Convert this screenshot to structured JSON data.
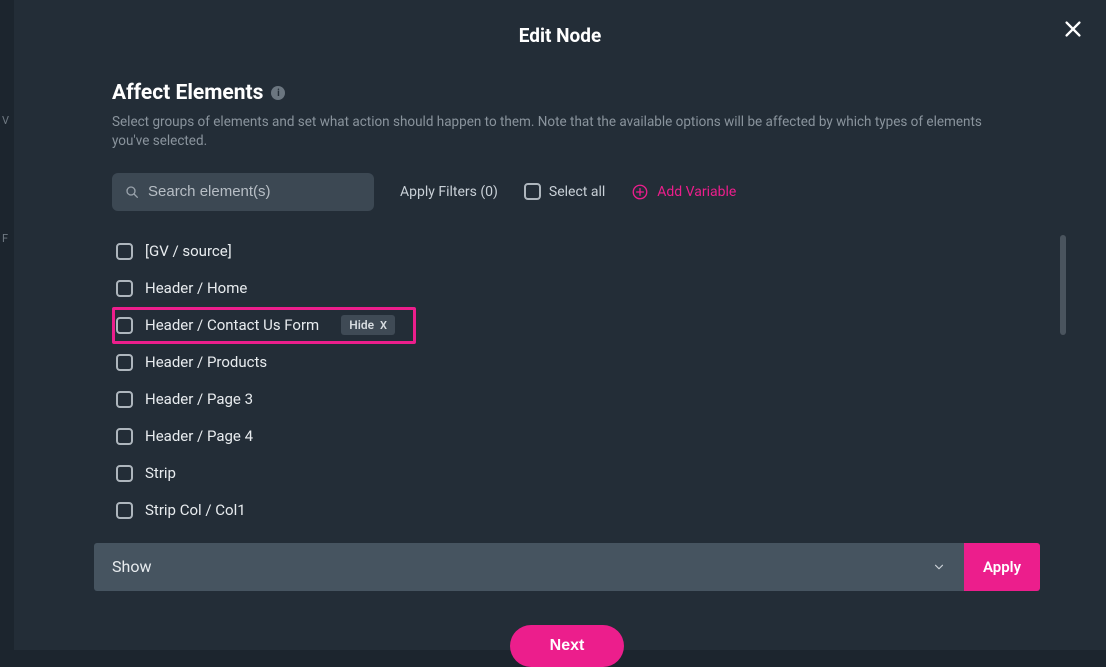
{
  "modal": {
    "title": "Edit Node",
    "section_title": "Affect Elements",
    "section_desc": "Select groups of elements and set what action should happen to them. Note that the available options will be affected by which types of elements you've selected.",
    "search_placeholder": "Search element(s)",
    "apply_filters_label": "Apply Filters (0)",
    "select_all_label": "Select all",
    "add_variable_label": "Add Variable",
    "action_select_value": "Show",
    "apply_button_label": "Apply",
    "next_button_label": "Next"
  },
  "elements": [
    {
      "label": "[GV / source]",
      "checked": false,
      "highlighted": false,
      "badge": null
    },
    {
      "label": "Header / Home",
      "checked": false,
      "highlighted": false,
      "badge": null
    },
    {
      "label": "Header / Contact Us Form",
      "checked": false,
      "highlighted": true,
      "badge": "Hide"
    },
    {
      "label": "Header / Products",
      "checked": false,
      "highlighted": false,
      "badge": null
    },
    {
      "label": "Header / Page 3",
      "checked": false,
      "highlighted": false,
      "badge": null
    },
    {
      "label": "Header / Page 4",
      "checked": false,
      "highlighted": false,
      "badge": null
    },
    {
      "label": "Strip",
      "checked": false,
      "highlighted": false,
      "badge": null
    },
    {
      "label": "Strip Col / Col1",
      "checked": false,
      "highlighted": false,
      "badge": null
    }
  ],
  "edge": {
    "v": "V",
    "f": "F"
  }
}
